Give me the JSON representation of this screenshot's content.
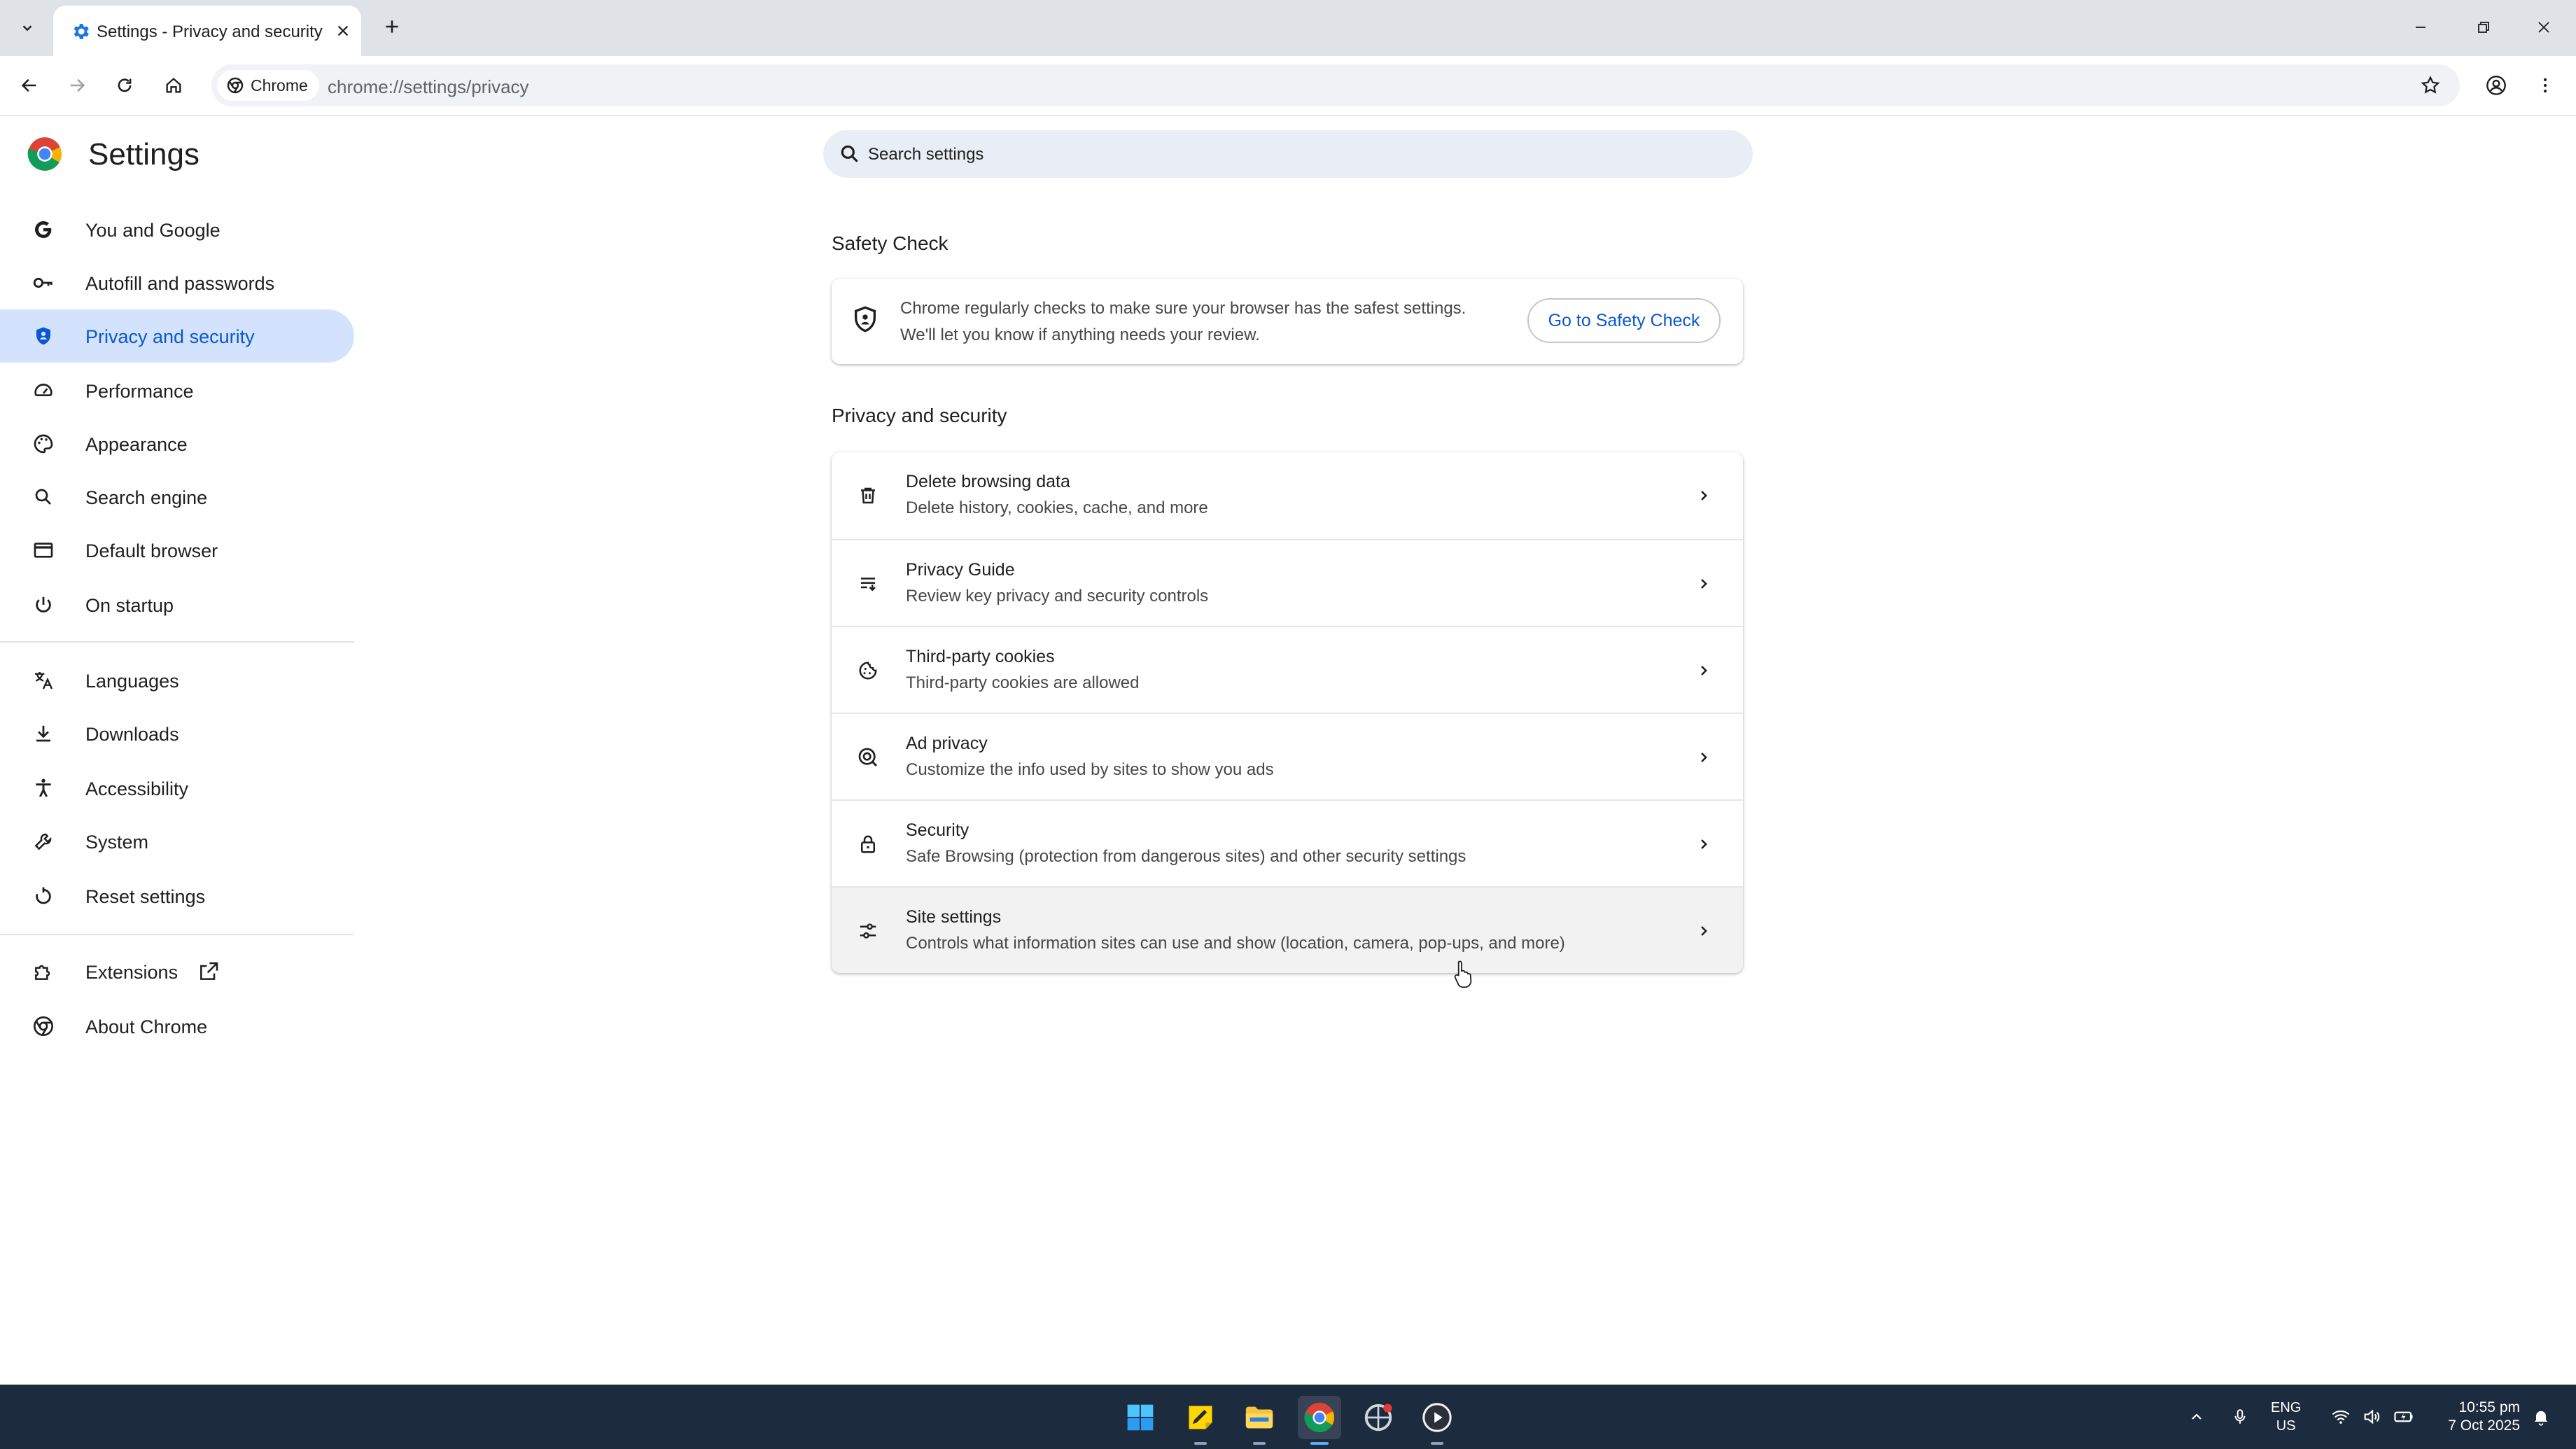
{
  "browser": {
    "tab_title": "Settings - Privacy and security",
    "chip_label": "Chrome",
    "url": "chrome://settings/privacy"
  },
  "settings": {
    "title": "Settings",
    "search_placeholder": "Search settings"
  },
  "sidebar": {
    "items": [
      {
        "label": "You and Google",
        "icon": "google-icon"
      },
      {
        "label": "Autofill and passwords",
        "icon": "key-icon"
      },
      {
        "label": "Privacy and security",
        "icon": "shield-icon",
        "active": true
      },
      {
        "label": "Performance",
        "icon": "speedometer-icon"
      },
      {
        "label": "Appearance",
        "icon": "palette-icon"
      },
      {
        "label": "Search engine",
        "icon": "search-icon"
      },
      {
        "label": "Default browser",
        "icon": "browser-window-icon"
      },
      {
        "label": "On startup",
        "icon": "power-icon"
      },
      {
        "label": "Languages",
        "icon": "translate-icon"
      },
      {
        "label": "Downloads",
        "icon": "download-icon"
      },
      {
        "label": "Accessibility",
        "icon": "accessibility-icon"
      },
      {
        "label": "System",
        "icon": "wrench-icon"
      },
      {
        "label": "Reset settings",
        "icon": "reset-icon"
      },
      {
        "label": "Extensions",
        "icon": "puzzle-icon"
      },
      {
        "label": "About Chrome",
        "icon": "chrome-icon"
      }
    ]
  },
  "safety_check": {
    "heading": "Safety Check",
    "line1": "Chrome regularly checks to make sure your browser has the safest settings.",
    "line2": "We'll let you know if anything needs your review.",
    "button": "Go to Safety Check"
  },
  "privacy": {
    "heading": "Privacy and security",
    "rows": [
      {
        "title": "Delete browsing data",
        "subtitle": "Delete history, cookies, cache, and more",
        "icon": "trash-icon"
      },
      {
        "title": "Privacy Guide",
        "subtitle": "Review key privacy and security controls",
        "icon": "privacy-guide-icon"
      },
      {
        "title": "Third-party cookies",
        "subtitle": "Third-party cookies are allowed",
        "icon": "cookie-icon"
      },
      {
        "title": "Ad privacy",
        "subtitle": "Customize the info used by sites to show you ads",
        "icon": "ad-privacy-icon"
      },
      {
        "title": "Security",
        "subtitle": "Safe Browsing (protection from dangerous sites) and other security settings",
        "icon": "lock-icon"
      },
      {
        "title": "Site settings",
        "subtitle": "Controls what information sites can use and show (location, camera, pop-ups, and more)",
        "icon": "sliders-icon"
      }
    ]
  },
  "taskbar": {
    "lang_top": "ENG",
    "lang_bottom": "US",
    "time": "10:55 pm",
    "date": "7 Oct 2025"
  },
  "colors": {
    "accent": "#0b57d0",
    "active_nav_bg": "#d3e3fd",
    "taskbar_bg": "#1d2b3f"
  }
}
